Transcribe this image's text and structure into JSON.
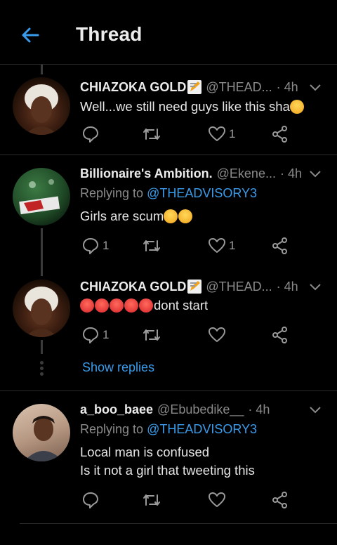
{
  "header": {
    "title": "Thread"
  },
  "tweets": [
    {
      "name": "CHIAZOKA GOLD",
      "handle": "@THEAD...",
      "time": "· 4h",
      "text": "Well...we still need guys like this sha",
      "reply_count": "",
      "retweet_count": "",
      "like_count": "1"
    },
    {
      "name": "Billionaire's Ambition.",
      "handle": "@Ekene...",
      "time": "· 4h",
      "replying_label": "Replying to",
      "replying_to": "@THEADVISORY3",
      "text": "Girls are scum",
      "reply_count": "1",
      "retweet_count": "",
      "like_count": "1"
    },
    {
      "name": "CHIAZOKA GOLD",
      "handle": "@THEAD...",
      "time": "· 4h",
      "text": "dont start",
      "reply_count": "1",
      "retweet_count": "",
      "like_count": ""
    },
    {
      "name": "a_boo_baee",
      "handle": "@Ebubedike__",
      "time": "· 4h",
      "replying_label": "Replying to",
      "replying_to": "@THEADVISORY3",
      "text_line1": "Local man is confused",
      "text_line2": "Is it not a girl that tweeting this",
      "reply_count": "",
      "retweet_count": "",
      "like_count": ""
    }
  ],
  "show_replies": "Show replies",
  "colors": {
    "accent": "#3a9bea",
    "background": "#000000",
    "divider": "#2a2a2a"
  },
  "icons": [
    "back-arrow-icon",
    "chevron-down-icon",
    "reply-icon",
    "retweet-icon",
    "like-icon",
    "share-icon",
    "memo-emoji-icon"
  ]
}
